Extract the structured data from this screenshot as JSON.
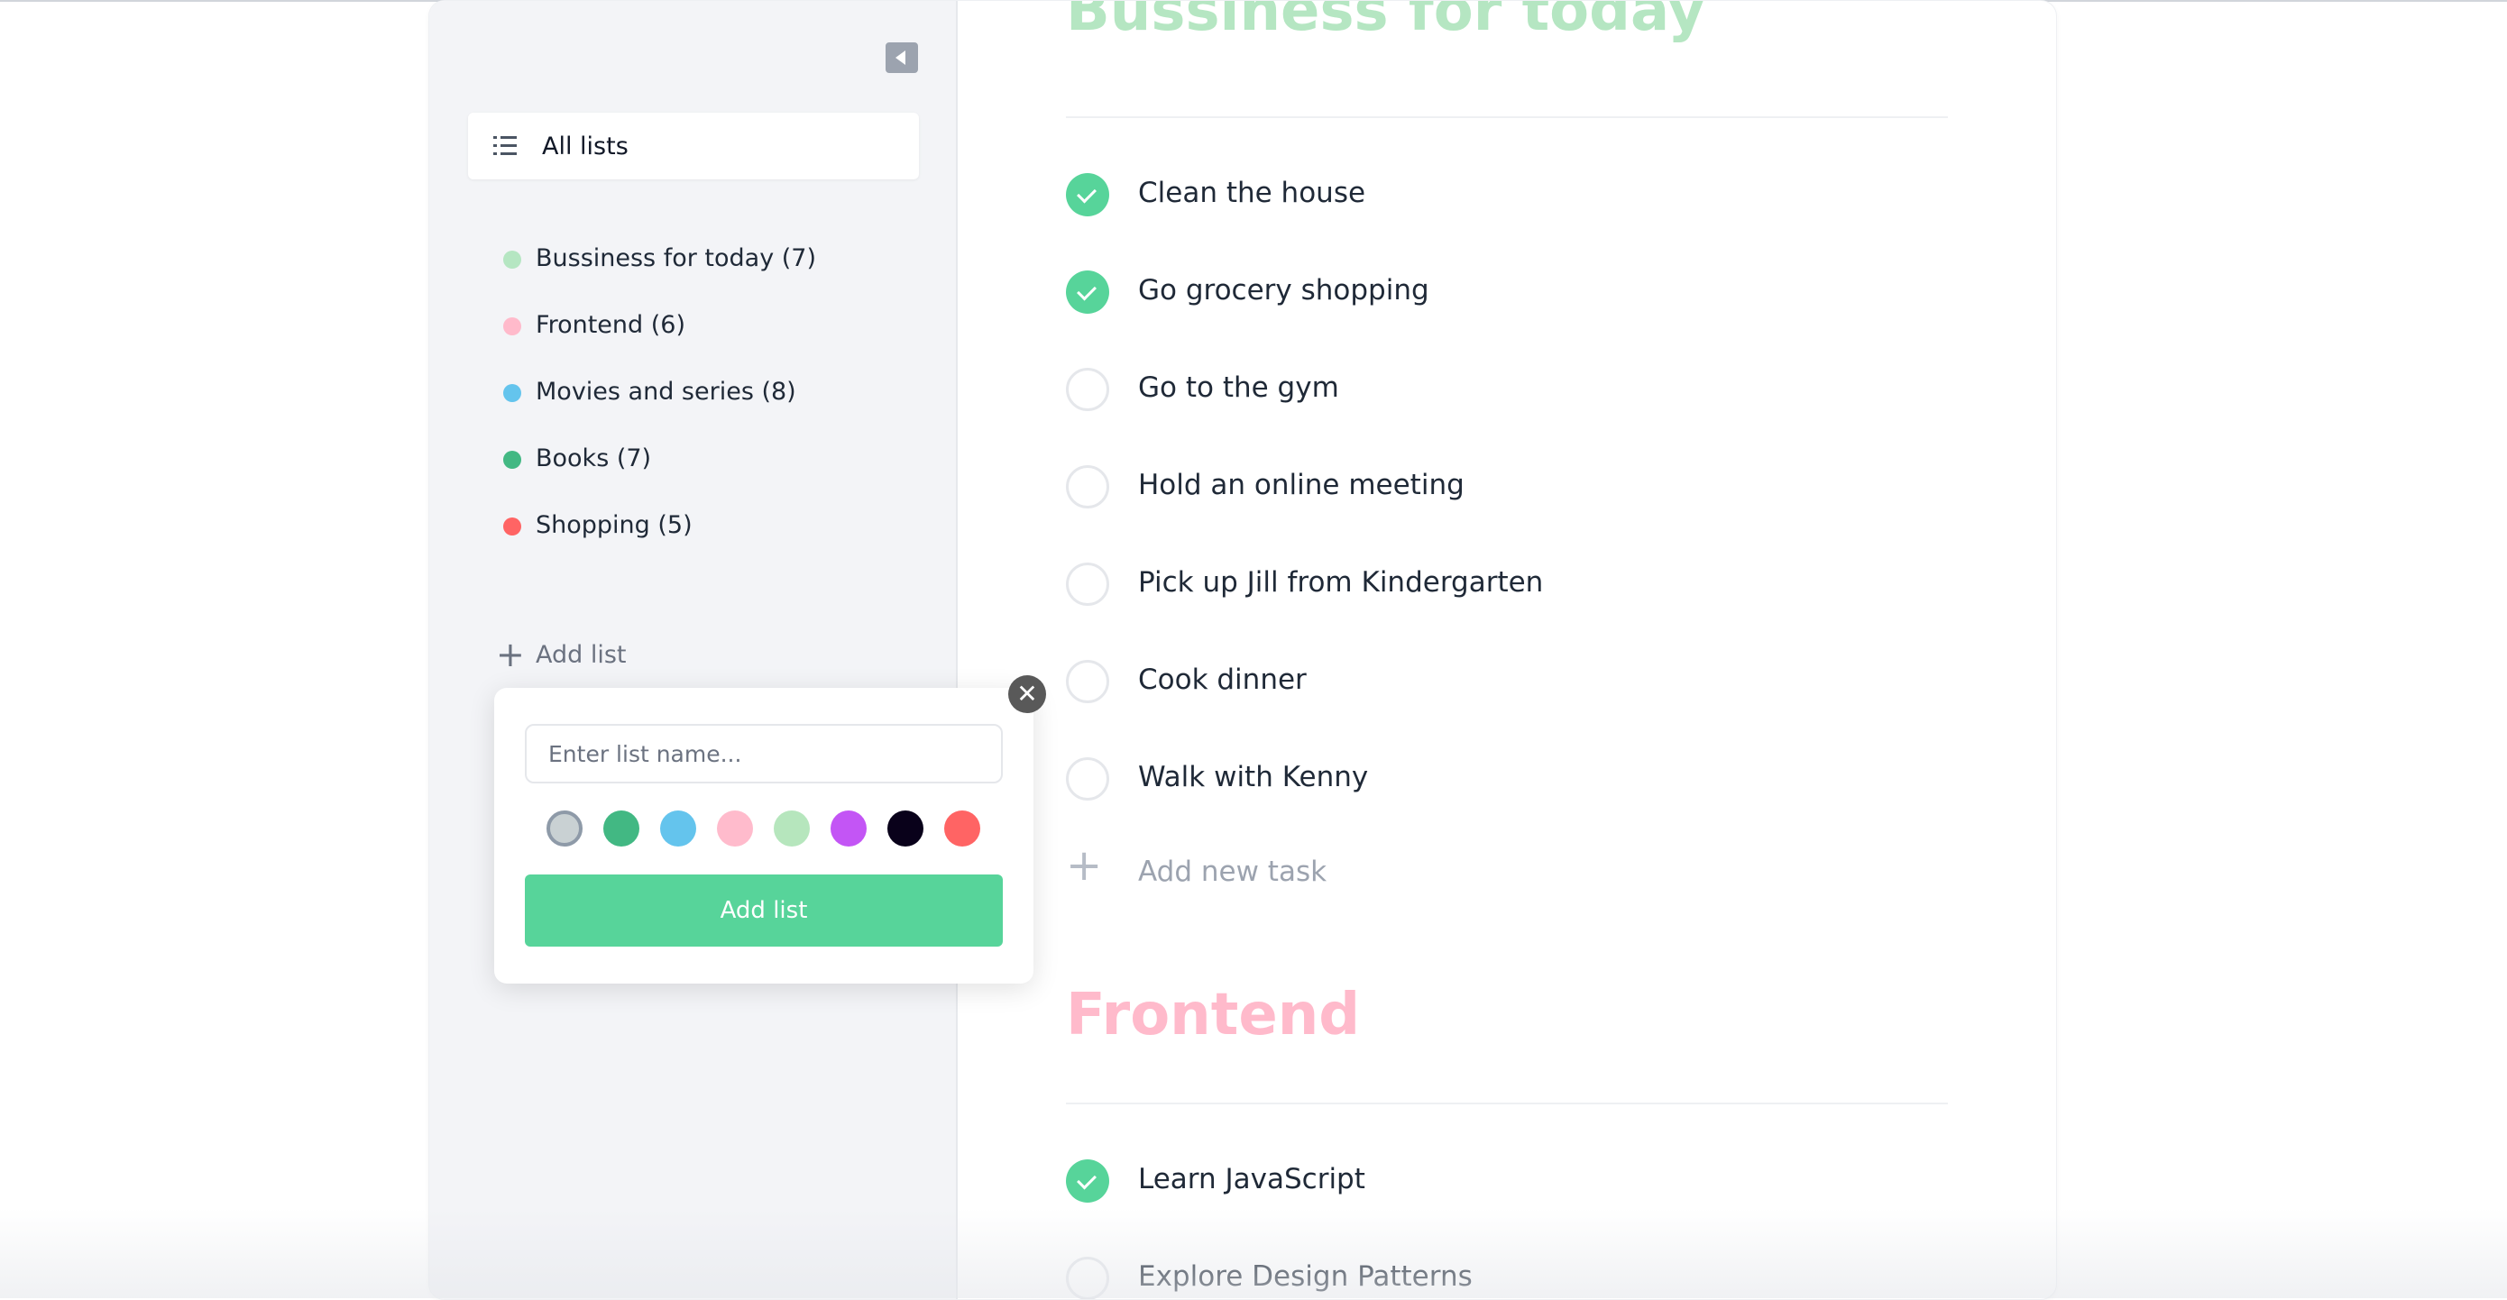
{
  "sidebar": {
    "collapse_icon": "caret-left-icon",
    "all_lists_icon": "list-icon",
    "all_lists_label": "All lists",
    "items": [
      {
        "label": "Bussiness for today (7)",
        "color": "#b5e6c2"
      },
      {
        "label": "Frontend (6)",
        "color": "#ffbacb"
      },
      {
        "label": "Movies and series (8)",
        "color": "#64c4ed"
      },
      {
        "label": "Books (7)",
        "color": "#42b883"
      },
      {
        "label": "Shopping (5)",
        "color": "#ff6464"
      }
    ],
    "add_list_icon": "plus-icon",
    "add_list_label": "Add list"
  },
  "popup": {
    "close_icon": "close-icon",
    "close_glyph": "✕",
    "input_value": "",
    "input_placeholder": "Enter list name...",
    "colors": [
      "#c9d1d3",
      "#42b883",
      "#64c4ed",
      "#ffbbcc",
      "#b6e6bd",
      "#c355f5",
      "#09011a",
      "#ff6464"
    ],
    "selected_color_index": 0,
    "submit_label": "Add list"
  },
  "main": {
    "sections": [
      {
        "title": "Bussiness for today",
        "color": "#b5e6c2",
        "tasks": [
          {
            "label": "Clean the house",
            "done": true
          },
          {
            "label": "Go grocery shopping",
            "done": true
          },
          {
            "label": "Go to the gym",
            "done": false
          },
          {
            "label": "Hold an online meeting",
            "done": false
          },
          {
            "label": "Pick up Jill from Kindergarten",
            "done": false
          },
          {
            "label": "Cook dinner",
            "done": false
          },
          {
            "label": "Walk with Kenny",
            "done": false
          }
        ],
        "add_task_icon": "plus-icon",
        "add_task_label": "Add new task"
      },
      {
        "title": "Frontend",
        "color": "#ffbacb",
        "tasks": [
          {
            "label": "Learn JavaScript",
            "done": true
          },
          {
            "label": "Explore Design Patterns",
            "done": false
          }
        ]
      }
    ]
  }
}
